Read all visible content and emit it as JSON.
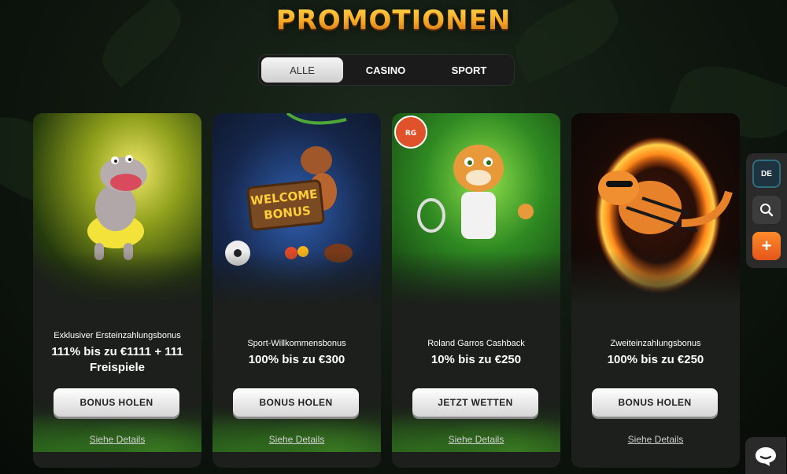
{
  "page": {
    "title": "PROMOTIONEN"
  },
  "tabs": [
    {
      "label": "ALLE",
      "active": true
    },
    {
      "label": "CASINO",
      "active": false
    },
    {
      "label": "SPORT",
      "active": false
    }
  ],
  "cards": [
    {
      "subtitle": "Exklusiver Ersteinzahlungsbonus",
      "main": "111% bis zu €1111 + 111 Freispiele",
      "button": "BONUS HOLEN",
      "details": "Siehe Details",
      "art": "hippo-illustration"
    },
    {
      "subtitle": "Sport-Willkommensbonus",
      "main": "100% bis zu €300",
      "button": "BONUS HOLEN",
      "details": "Siehe Details",
      "art": "monkey-welcome-bonus-illustration",
      "sign_text": "WELCOME BONUS"
    },
    {
      "subtitle": "Roland Garros Cashback",
      "main": "10% bis zu €250",
      "button": "JETZT WETTEN",
      "details": "Siehe Details",
      "art": "tiger-tennis-illustration",
      "badge": "ROLAND GARROS"
    },
    {
      "subtitle": "Zweiteinzahlungsbonus",
      "main": "100% bis zu €250",
      "button": "BONUS HOLEN",
      "details": "Siehe Details",
      "art": "tiger-fire-ring-illustration"
    }
  ],
  "side": {
    "language": "DE",
    "search_icon": "search-icon",
    "plus_icon": "plus-icon"
  },
  "chat": {
    "icon": "chat-icon"
  },
  "colors": {
    "accent_orange": "#f6a623",
    "button_bg": "#e6e6e6",
    "card_bg": "#1c1f1b"
  }
}
